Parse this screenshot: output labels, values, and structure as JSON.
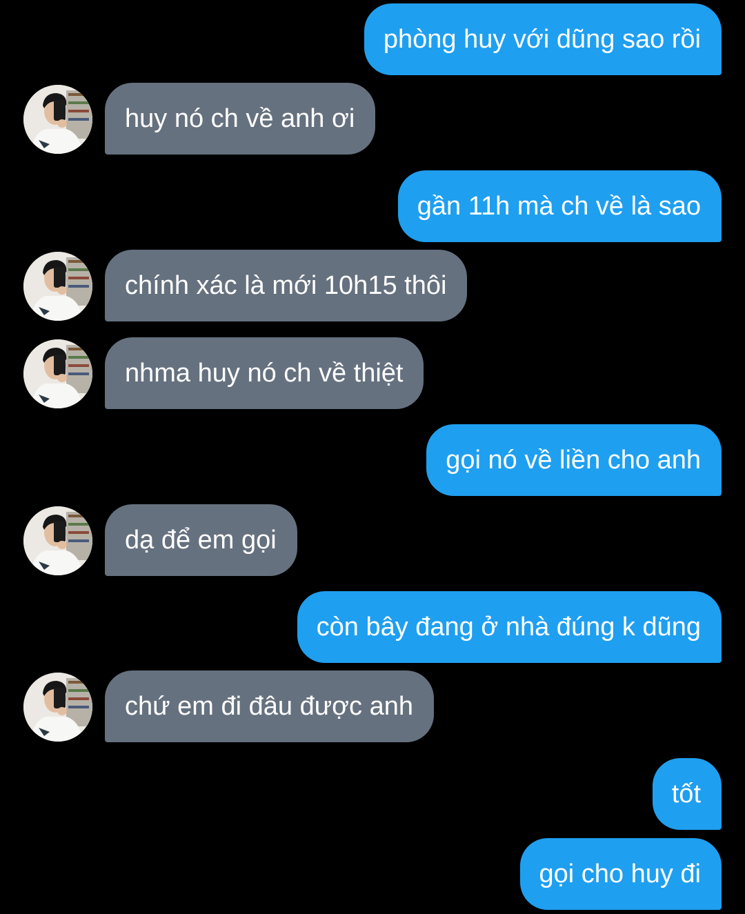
{
  "conversation": {
    "messages": [
      {
        "sender": "me",
        "text": "phòng huy với dũng sao rồi"
      },
      {
        "sender": "contact",
        "text": "huy nó ch về anh ơi"
      },
      {
        "sender": "me",
        "text": "gần 11h mà ch về là sao"
      },
      {
        "sender": "contact",
        "text": "chính xác là mới 10h15 thôi"
      },
      {
        "sender": "contact",
        "text": "nhma huy nó ch về thiệt"
      },
      {
        "sender": "me",
        "text": "gọi nó về liền cho anh"
      },
      {
        "sender": "contact",
        "text": "dạ để em gọi"
      },
      {
        "sender": "me",
        "text": "còn bây đang ở nhà đúng k dũng"
      },
      {
        "sender": "contact",
        "text": "chứ em đi đâu được anh"
      },
      {
        "sender": "me",
        "text": "tốt"
      },
      {
        "sender": "me",
        "text": "gọi cho huy đi"
      }
    ]
  },
  "theme": {
    "background": "#000000",
    "sent_bubble_color": "#1f9ff0",
    "received_bubble_color": "#66717f",
    "text_color": "#ffffff"
  },
  "icons": {
    "contact_avatar": "contact-avatar-photo"
  }
}
